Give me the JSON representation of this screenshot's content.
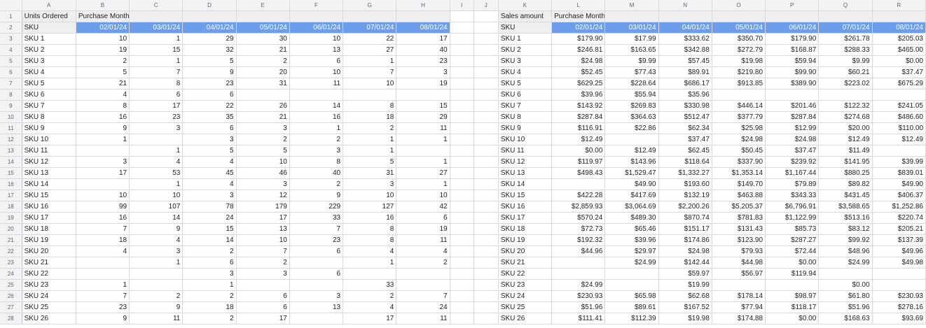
{
  "columns": [
    "A",
    "B",
    "C",
    "D",
    "E",
    "F",
    "G",
    "H",
    "I",
    "J",
    "K",
    "L",
    "M",
    "N",
    "O",
    "P",
    "Q",
    "R"
  ],
  "left_table": {
    "title": "Units Ordered",
    "subtitle": "Purchase Month Year",
    "sku_label": "SKU",
    "dates": [
      "02/01/24",
      "03/01/24",
      "04/01/24",
      "05/01/24",
      "06/01/24",
      "07/01/24",
      "08/01/24"
    ],
    "rows": [
      {
        "sku": "SKU 1",
        "v": [
          "10",
          "1",
          "29",
          "30",
          "10",
          "22",
          "17"
        ]
      },
      {
        "sku": "SKU 2",
        "v": [
          "19",
          "15",
          "32",
          "21",
          "13",
          "27",
          "40"
        ]
      },
      {
        "sku": "SKU 3",
        "v": [
          "2",
          "1",
          "5",
          "2",
          "6",
          "1",
          "23"
        ]
      },
      {
        "sku": "SKU 4",
        "v": [
          "5",
          "7",
          "9",
          "20",
          "10",
          "7",
          "3"
        ]
      },
      {
        "sku": "SKU 5",
        "v": [
          "21",
          "8",
          "23",
          "31",
          "11",
          "10",
          "19"
        ]
      },
      {
        "sku": "SKU 6",
        "v": [
          "4",
          "6",
          "6",
          "",
          "",
          "",
          ""
        ]
      },
      {
        "sku": "SKU 7",
        "v": [
          "8",
          "17",
          "22",
          "26",
          "14",
          "8",
          "15"
        ]
      },
      {
        "sku": "SKU 8",
        "v": [
          "16",
          "23",
          "35",
          "21",
          "16",
          "18",
          "29"
        ]
      },
      {
        "sku": "SKU 9",
        "v": [
          "9",
          "3",
          "6",
          "3",
          "1",
          "2",
          "11"
        ]
      },
      {
        "sku": "SKU 10",
        "v": [
          "1",
          "",
          "3",
          "2",
          "2",
          "1",
          "1"
        ]
      },
      {
        "sku": "SKU 11",
        "v": [
          "",
          "1",
          "5",
          "5",
          "3",
          "1",
          ""
        ]
      },
      {
        "sku": "SKU 12",
        "v": [
          "3",
          "4",
          "4",
          "10",
          "8",
          "5",
          "1"
        ]
      },
      {
        "sku": "SKU 13",
        "v": [
          "17",
          "53",
          "45",
          "46",
          "40",
          "31",
          "27"
        ]
      },
      {
        "sku": "SKU 14",
        "v": [
          "",
          "1",
          "4",
          "3",
          "2",
          "3",
          "1"
        ]
      },
      {
        "sku": "SKU 15",
        "v": [
          "10",
          "10",
          "3",
          "12",
          "9",
          "10",
          "10"
        ]
      },
      {
        "sku": "SKU 16",
        "v": [
          "99",
          "107",
          "78",
          "179",
          "229",
          "127",
          "42"
        ]
      },
      {
        "sku": "SKU 17",
        "v": [
          "16",
          "14",
          "24",
          "17",
          "33",
          "16",
          "6"
        ]
      },
      {
        "sku": "SKU 18",
        "v": [
          "7",
          "9",
          "15",
          "13",
          "7",
          "8",
          "19"
        ]
      },
      {
        "sku": "SKU 19",
        "v": [
          "18",
          "4",
          "14",
          "10",
          "23",
          "8",
          "11"
        ]
      },
      {
        "sku": "SKU 20",
        "v": [
          "4",
          "3",
          "2",
          "7",
          "6",
          "4",
          "4"
        ]
      },
      {
        "sku": "SKU 21",
        "v": [
          "",
          "1",
          "6",
          "2",
          "",
          "1",
          "2"
        ]
      },
      {
        "sku": "SKU 22",
        "v": [
          "",
          "",
          "3",
          "3",
          "6",
          "",
          ""
        ]
      },
      {
        "sku": "SKU 23",
        "v": [
          "1",
          "",
          "1",
          "",
          "",
          "33",
          ""
        ]
      },
      {
        "sku": "SKU 24",
        "v": [
          "7",
          "2",
          "2",
          "6",
          "3",
          "2",
          "7"
        ]
      },
      {
        "sku": "SKU 25",
        "v": [
          "23",
          "9",
          "18",
          "6",
          "13",
          "4",
          "24"
        ]
      },
      {
        "sku": "SKU 26",
        "v": [
          "9",
          "11",
          "2",
          "17",
          "",
          "17",
          "11"
        ]
      }
    ]
  },
  "right_table": {
    "title": "Sales amount",
    "subtitle": "Purchase Month Year",
    "sku_label": "SKU",
    "dates": [
      "02/01/24",
      "03/01/24",
      "04/01/24",
      "05/01/24",
      "06/01/24",
      "07/01/24",
      "08/01/24"
    ],
    "rows": [
      {
        "sku": "SKU 1",
        "v": [
          "$179.90",
          "$17.99",
          "$333.62",
          "$350.70",
          "$179.90",
          "$261.78",
          "$205.03"
        ]
      },
      {
        "sku": "SKU 2",
        "v": [
          "$246.81",
          "$163.65",
          "$342.88",
          "$272.79",
          "$168.87",
          "$288.33",
          "$465.00"
        ]
      },
      {
        "sku": "SKU 3",
        "v": [
          "$24.98",
          "$9.99",
          "$57.45",
          "$19.98",
          "$59.94",
          "$9.99",
          "$0.00"
        ]
      },
      {
        "sku": "SKU 4",
        "v": [
          "$52.45",
          "$77.43",
          "$89.91",
          "$219.80",
          "$99.90",
          "$60.21",
          "$37.47"
        ]
      },
      {
        "sku": "SKU 5",
        "v": [
          "$629.25",
          "$228.64",
          "$686.17",
          "$913.85",
          "$389.90",
          "$223.02",
          "$675.29"
        ]
      },
      {
        "sku": "SKU 6",
        "v": [
          "$39.96",
          "$55.94",
          "$35.96",
          "",
          "",
          "",
          ""
        ]
      },
      {
        "sku": "SKU 7",
        "v": [
          "$143.92",
          "$269.83",
          "$330.98",
          "$446.14",
          "$201.46",
          "$122.32",
          "$241.05"
        ]
      },
      {
        "sku": "SKU 8",
        "v": [
          "$287.84",
          "$364.63",
          "$512.47",
          "$377.79",
          "$287.84",
          "$274.68",
          "$486.60"
        ]
      },
      {
        "sku": "SKU 9",
        "v": [
          "$116.91",
          "$22.86",
          "$62.34",
          "$25.98",
          "$12.99",
          "$20.00",
          "$110.00"
        ]
      },
      {
        "sku": "SKU 10",
        "v": [
          "$12.49",
          "",
          "$37.47",
          "$24.98",
          "$24.98",
          "$12.49",
          "$12.49"
        ]
      },
      {
        "sku": "SKU 11",
        "v": [
          "$0.00",
          "$12.49",
          "$62.45",
          "$50.45",
          "$37.47",
          "$11.49",
          ""
        ]
      },
      {
        "sku": "SKU 12",
        "v": [
          "$119.97",
          "$143.96",
          "$118.64",
          "$337.90",
          "$239.92",
          "$141.95",
          "$39.99"
        ]
      },
      {
        "sku": "SKU 13",
        "v": [
          "$498.43",
          "$1,529.47",
          "$1,332.27",
          "$1,353.14",
          "$1,167.44",
          "$880.25",
          "$839.01"
        ]
      },
      {
        "sku": "SKU 14",
        "v": [
          "",
          "$49.90",
          "$193.60",
          "$149.70",
          "$79.89",
          "$89.82",
          "$49.90"
        ]
      },
      {
        "sku": "SKU 15",
        "v": [
          "$422.28",
          "$417.69",
          "$132.19",
          "$463.88",
          "$343.33",
          "$431.45",
          "$406.37"
        ]
      },
      {
        "sku": "SKU 16",
        "v": [
          "$2,859.93",
          "$3,064.69",
          "$2,200.26",
          "$5,205.37",
          "$6,796.91",
          "$3,588.65",
          "$1,252.86"
        ]
      },
      {
        "sku": "SKU 17",
        "v": [
          "$570.24",
          "$489.30",
          "$870.74",
          "$781.83",
          "$1,122.99",
          "$513.16",
          "$220.74"
        ]
      },
      {
        "sku": "SKU 18",
        "v": [
          "$72.73",
          "$65.46",
          "$151.17",
          "$131.43",
          "$85.73",
          "$83.12",
          "$205.21"
        ]
      },
      {
        "sku": "SKU 19",
        "v": [
          "$192.32",
          "$39.96",
          "$174.86",
          "$123.90",
          "$287.27",
          "$99.92",
          "$137.39"
        ]
      },
      {
        "sku": "SKU 20",
        "v": [
          "$44.96",
          "$29.97",
          "$24.98",
          "$79.93",
          "$72.44",
          "$48.96",
          "$49.96"
        ]
      },
      {
        "sku": "SKU 21",
        "v": [
          "",
          "$24.99",
          "$142.44",
          "$44.98",
          "$0.00",
          "$24.99",
          "$49.98"
        ]
      },
      {
        "sku": "SKU 22",
        "v": [
          "",
          "",
          "$59.97",
          "$56.97",
          "$119.94",
          "",
          ""
        ]
      },
      {
        "sku": "SKU 23",
        "v": [
          "$24.99",
          "",
          "$19.99",
          "",
          "",
          "$0.00",
          ""
        ]
      },
      {
        "sku": "SKU 24",
        "v": [
          "$230.93",
          "$65.98",
          "$62.68",
          "$178.14",
          "$98.97",
          "$61.80",
          "$230.93"
        ]
      },
      {
        "sku": "SKU 25",
        "v": [
          "$51.96",
          "$89.61",
          "$167.52",
          "$77.94",
          "$118.17",
          "$51.96",
          "$278.16"
        ]
      },
      {
        "sku": "SKU 26",
        "v": [
          "$111.41",
          "$112.39",
          "$19.98",
          "$174.88",
          "$0.00",
          "$168.63",
          "$93.69"
        ]
      }
    ]
  }
}
